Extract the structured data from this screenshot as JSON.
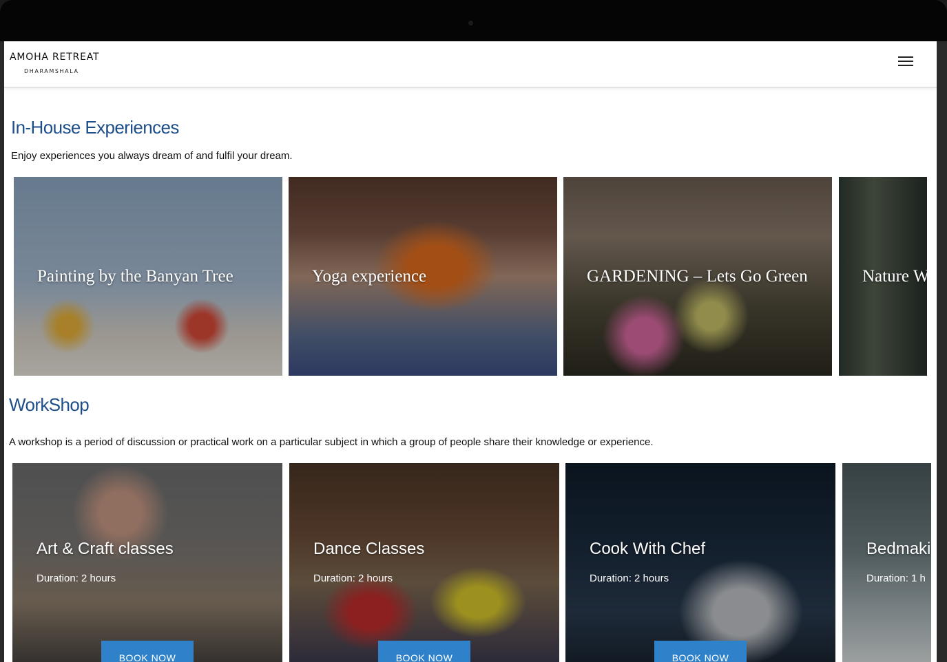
{
  "header": {
    "brand_name": "AMOHA RETREAT",
    "brand_location": "DHARAMSHALA",
    "menu_icon": "hamburger-menu-icon"
  },
  "in_house": {
    "title": "In-House Experiences",
    "description": "Enjoy experiences you always dream of and fulfil your dream.",
    "cards": [
      {
        "title": "Painting by the Banyan Tree"
      },
      {
        "title": "Yoga experience"
      },
      {
        "title": "GARDENING – Lets Go Green"
      },
      {
        "title": "Nature W"
      }
    ]
  },
  "workshop": {
    "title": "WorkShop",
    "description": "A workshop is a period of discussion or practical work on a particular subject in which a group of people share their knowledge or experience.",
    "cards": [
      {
        "title": "Art & Craft classes",
        "duration": "Duration: 2 hours",
        "button": "BOOK NOW"
      },
      {
        "title": "Dance Classes",
        "duration": "Duration: 2 hours",
        "button": "BOOK NOW"
      },
      {
        "title": "Cook With Chef",
        "duration": "Duration: 2 hours",
        "button": "BOOK NOW"
      },
      {
        "title": "Bedmaki",
        "duration": "Duration: 1 h"
      }
    ]
  }
}
